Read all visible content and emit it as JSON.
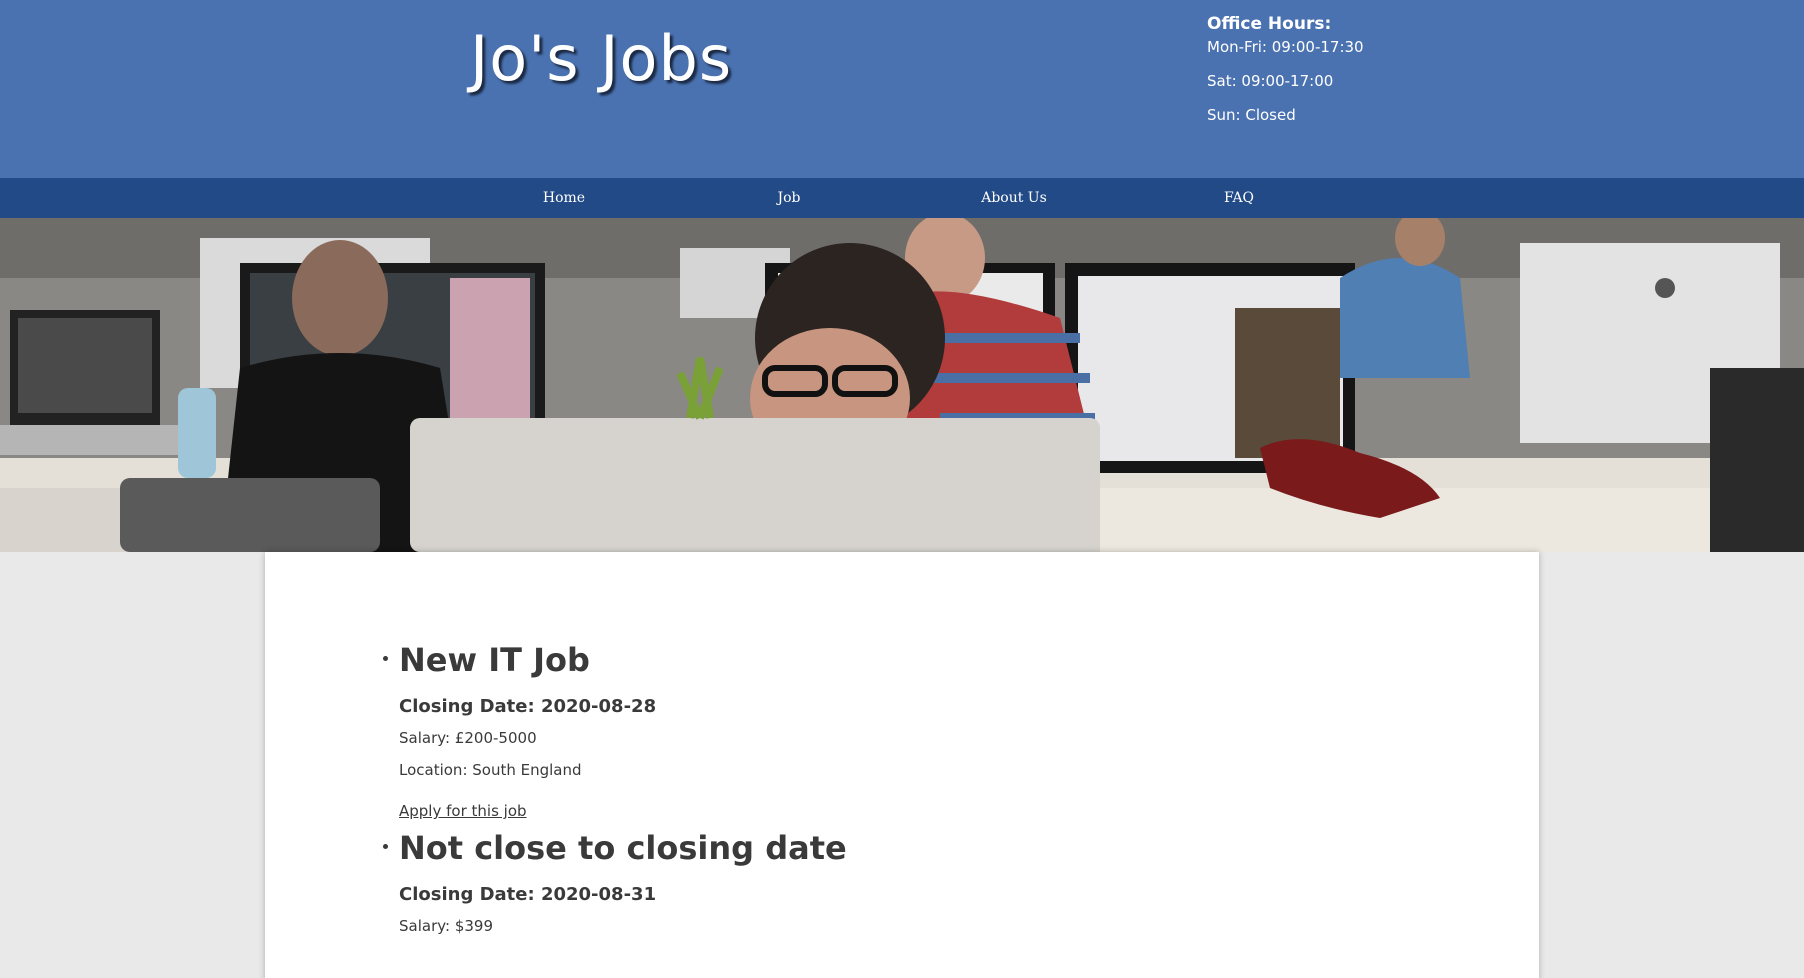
{
  "header": {
    "site_title": "Jo's Jobs",
    "office_hours": {
      "heading": "Office Hours:",
      "lines": [
        "Mon-Fri: 09:00-17:30",
        "Sat: 09:00-17:00",
        "Sun: Closed"
      ]
    }
  },
  "nav": {
    "items": [
      {
        "label": "Home"
      },
      {
        "label": "Job"
      },
      {
        "label": "About Us"
      },
      {
        "label": "FAQ"
      }
    ]
  },
  "jobs": [
    {
      "title": "New IT Job",
      "closing": "Closing Date: 2020-08-28",
      "salary": "Salary: £200-5000",
      "location": "Location: South England",
      "apply_label": "Apply for this job"
    },
    {
      "title": "Not close to closing date",
      "closing": "Closing Date: 2020-08-31",
      "salary": "Salary: $399"
    }
  ],
  "colors": {
    "header_bg": "#4a72b0",
    "nav_bg": "#224a86",
    "page_bg": "#e9e9e9"
  }
}
